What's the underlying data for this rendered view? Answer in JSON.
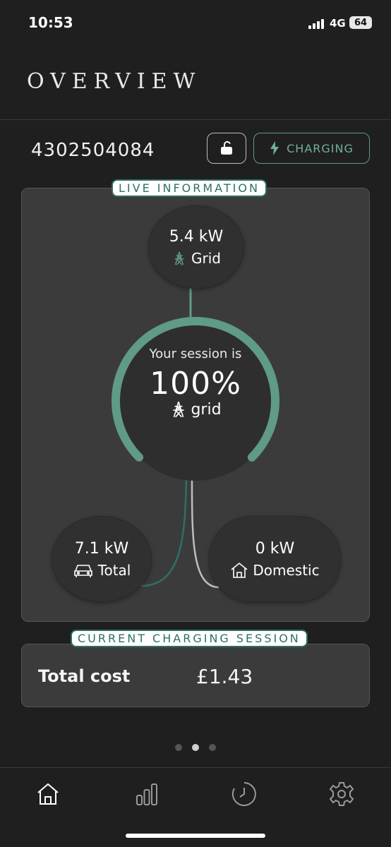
{
  "status_bar": {
    "time": "10:53",
    "network": "4G",
    "battery": "64"
  },
  "header": {
    "title": "OVERVIEW"
  },
  "charger": {
    "id": "4302504084",
    "status_label": "CHARGING"
  },
  "live_information": {
    "tag": "LIVE INFORMATION",
    "grid_node": {
      "value": "5.4 kW",
      "label": "Grid",
      "icon": "pylon-icon"
    },
    "session": {
      "caption": "Your session is",
      "percent": "100%",
      "source": "grid",
      "progress": 1.0
    },
    "total_node": {
      "value": "7.1 kW",
      "label": "Total",
      "icon": "car-icon"
    },
    "domestic_node": {
      "value": "0 kW",
      "label": "Domestic",
      "icon": "house-icon"
    }
  },
  "current_session": {
    "tag": "CURRENT CHARGING SESSION",
    "cost_label": "Total cost",
    "cost_value": "£1.43"
  },
  "pagination": {
    "pages": 3,
    "active": 2
  },
  "tabs": [
    {
      "name": "home",
      "icon": "home-icon",
      "active": true
    },
    {
      "name": "stats",
      "icon": "bar-chart-icon",
      "active": false
    },
    {
      "name": "history",
      "icon": "clock-icon",
      "active": false
    },
    {
      "name": "settings",
      "icon": "gear-icon",
      "active": false
    }
  ],
  "colors": {
    "accent": "#5f9b86",
    "background": "#1f1f1f",
    "panel": "#3b3b3b"
  }
}
